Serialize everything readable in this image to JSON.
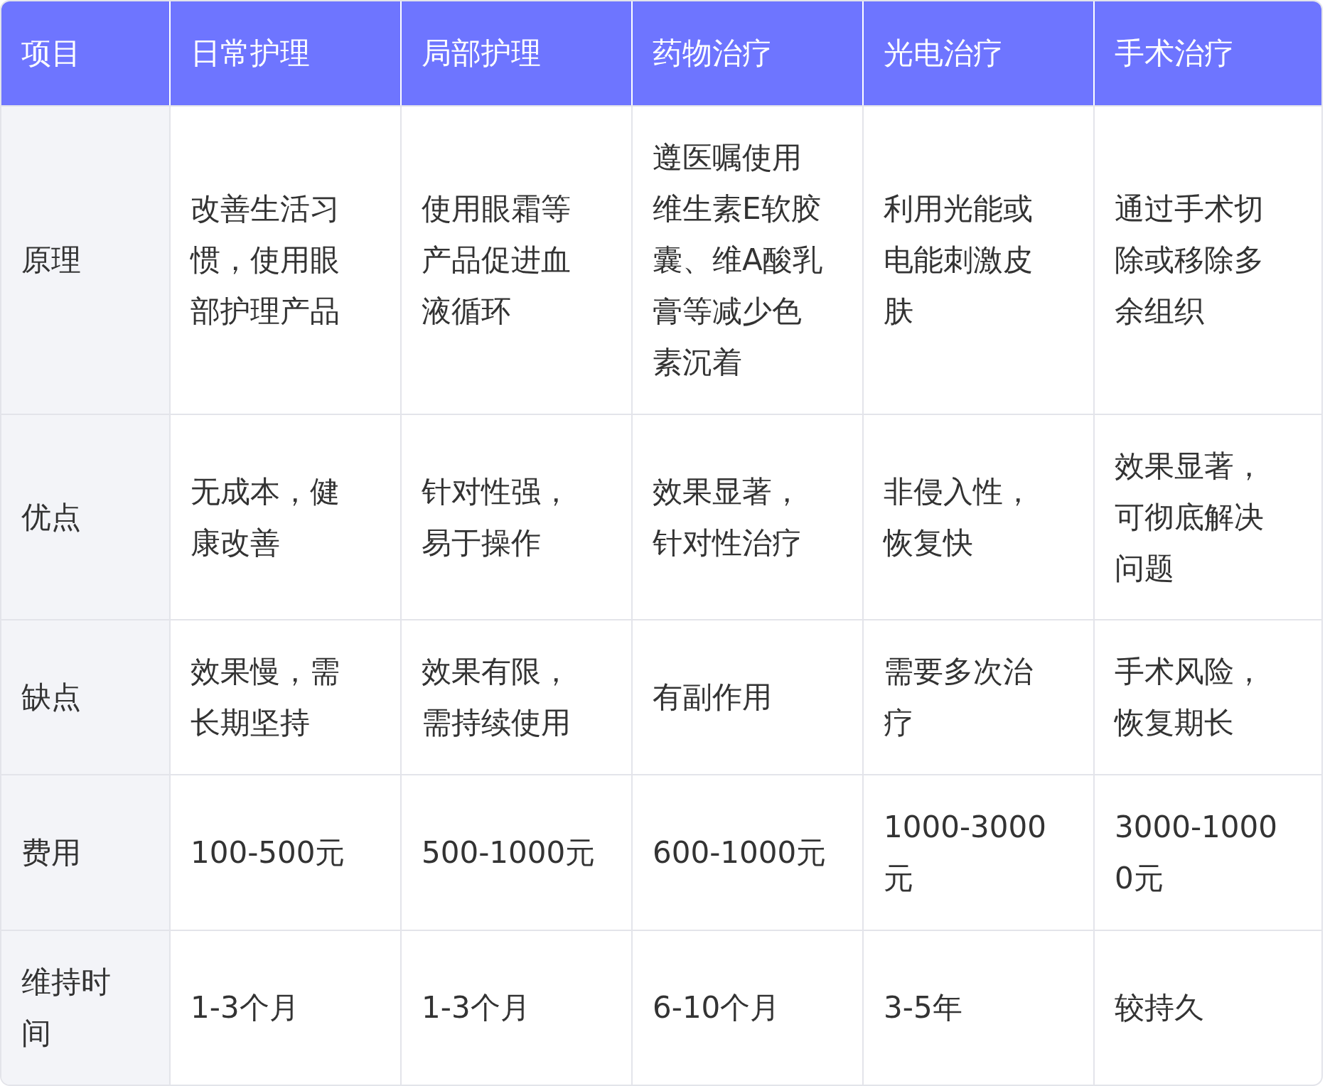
{
  "table": {
    "columns": [
      "项目",
      "日常护理",
      "局部护理",
      "药物治疗",
      "光电治疗",
      "手术治疗"
    ],
    "rows": [
      {
        "cells": [
          "原理",
          "改善生活习惯，使用眼部护理产品",
          "使用眼霜等产品促进血液循环",
          "遵医嘱使用维生素E软胶囊、维A酸乳膏等减少色素沉着",
          "利用光能或电能刺激皮肤",
          "通过手术切除或移除多余组织"
        ]
      },
      {
        "cells": [
          "优点",
          "无成本，健康改善",
          "针对性强，易于操作",
          "效果显著，针对性治疗",
          "非侵入性，恢复快",
          "效果显著，可彻底解决问题"
        ]
      },
      {
        "cells": [
          "缺点",
          "效果慢，需长期坚持",
          "效果有限，需持续使用",
          "有副作用",
          "需要多次治疗",
          "手术风险，恢复期长"
        ]
      },
      {
        "cells": [
          "费用",
          "100-500元",
          "500-1000元",
          "600-1000元",
          "1000-3000元",
          "3000-10000元"
        ]
      },
      {
        "cells": [
          "维持时间",
          "1-3个月",
          "1-3个月",
          "6-10个月",
          "3-5年",
          "较持久"
        ]
      }
    ]
  }
}
